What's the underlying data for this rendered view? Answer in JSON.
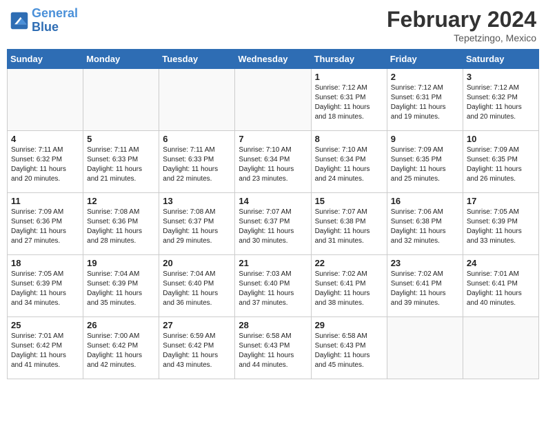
{
  "header": {
    "logo_line1": "General",
    "logo_line2": "Blue",
    "month_year": "February 2024",
    "location": "Tepetzingo, Mexico"
  },
  "days_of_week": [
    "Sunday",
    "Monday",
    "Tuesday",
    "Wednesday",
    "Thursday",
    "Friday",
    "Saturday"
  ],
  "weeks": [
    [
      {
        "day": "",
        "info": ""
      },
      {
        "day": "",
        "info": ""
      },
      {
        "day": "",
        "info": ""
      },
      {
        "day": "",
        "info": ""
      },
      {
        "day": "1",
        "info": "Sunrise: 7:12 AM\nSunset: 6:31 PM\nDaylight: 11 hours and 18 minutes."
      },
      {
        "day": "2",
        "info": "Sunrise: 7:12 AM\nSunset: 6:31 PM\nDaylight: 11 hours and 19 minutes."
      },
      {
        "day": "3",
        "info": "Sunrise: 7:12 AM\nSunset: 6:32 PM\nDaylight: 11 hours and 20 minutes."
      }
    ],
    [
      {
        "day": "4",
        "info": "Sunrise: 7:11 AM\nSunset: 6:32 PM\nDaylight: 11 hours and 20 minutes."
      },
      {
        "day": "5",
        "info": "Sunrise: 7:11 AM\nSunset: 6:33 PM\nDaylight: 11 hours and 21 minutes."
      },
      {
        "day": "6",
        "info": "Sunrise: 7:11 AM\nSunset: 6:33 PM\nDaylight: 11 hours and 22 minutes."
      },
      {
        "day": "7",
        "info": "Sunrise: 7:10 AM\nSunset: 6:34 PM\nDaylight: 11 hours and 23 minutes."
      },
      {
        "day": "8",
        "info": "Sunrise: 7:10 AM\nSunset: 6:34 PM\nDaylight: 11 hours and 24 minutes."
      },
      {
        "day": "9",
        "info": "Sunrise: 7:09 AM\nSunset: 6:35 PM\nDaylight: 11 hours and 25 minutes."
      },
      {
        "day": "10",
        "info": "Sunrise: 7:09 AM\nSunset: 6:35 PM\nDaylight: 11 hours and 26 minutes."
      }
    ],
    [
      {
        "day": "11",
        "info": "Sunrise: 7:09 AM\nSunset: 6:36 PM\nDaylight: 11 hours and 27 minutes."
      },
      {
        "day": "12",
        "info": "Sunrise: 7:08 AM\nSunset: 6:36 PM\nDaylight: 11 hours and 28 minutes."
      },
      {
        "day": "13",
        "info": "Sunrise: 7:08 AM\nSunset: 6:37 PM\nDaylight: 11 hours and 29 minutes."
      },
      {
        "day": "14",
        "info": "Sunrise: 7:07 AM\nSunset: 6:37 PM\nDaylight: 11 hours and 30 minutes."
      },
      {
        "day": "15",
        "info": "Sunrise: 7:07 AM\nSunset: 6:38 PM\nDaylight: 11 hours and 31 minutes."
      },
      {
        "day": "16",
        "info": "Sunrise: 7:06 AM\nSunset: 6:38 PM\nDaylight: 11 hours and 32 minutes."
      },
      {
        "day": "17",
        "info": "Sunrise: 7:05 AM\nSunset: 6:39 PM\nDaylight: 11 hours and 33 minutes."
      }
    ],
    [
      {
        "day": "18",
        "info": "Sunrise: 7:05 AM\nSunset: 6:39 PM\nDaylight: 11 hours and 34 minutes."
      },
      {
        "day": "19",
        "info": "Sunrise: 7:04 AM\nSunset: 6:39 PM\nDaylight: 11 hours and 35 minutes."
      },
      {
        "day": "20",
        "info": "Sunrise: 7:04 AM\nSunset: 6:40 PM\nDaylight: 11 hours and 36 minutes."
      },
      {
        "day": "21",
        "info": "Sunrise: 7:03 AM\nSunset: 6:40 PM\nDaylight: 11 hours and 37 minutes."
      },
      {
        "day": "22",
        "info": "Sunrise: 7:02 AM\nSunset: 6:41 PM\nDaylight: 11 hours and 38 minutes."
      },
      {
        "day": "23",
        "info": "Sunrise: 7:02 AM\nSunset: 6:41 PM\nDaylight: 11 hours and 39 minutes."
      },
      {
        "day": "24",
        "info": "Sunrise: 7:01 AM\nSunset: 6:41 PM\nDaylight: 11 hours and 40 minutes."
      }
    ],
    [
      {
        "day": "25",
        "info": "Sunrise: 7:01 AM\nSunset: 6:42 PM\nDaylight: 11 hours and 41 minutes."
      },
      {
        "day": "26",
        "info": "Sunrise: 7:00 AM\nSunset: 6:42 PM\nDaylight: 11 hours and 42 minutes."
      },
      {
        "day": "27",
        "info": "Sunrise: 6:59 AM\nSunset: 6:42 PM\nDaylight: 11 hours and 43 minutes."
      },
      {
        "day": "28",
        "info": "Sunrise: 6:58 AM\nSunset: 6:43 PM\nDaylight: 11 hours and 44 minutes."
      },
      {
        "day": "29",
        "info": "Sunrise: 6:58 AM\nSunset: 6:43 PM\nDaylight: 11 hours and 45 minutes."
      },
      {
        "day": "",
        "info": ""
      },
      {
        "day": "",
        "info": ""
      }
    ]
  ]
}
